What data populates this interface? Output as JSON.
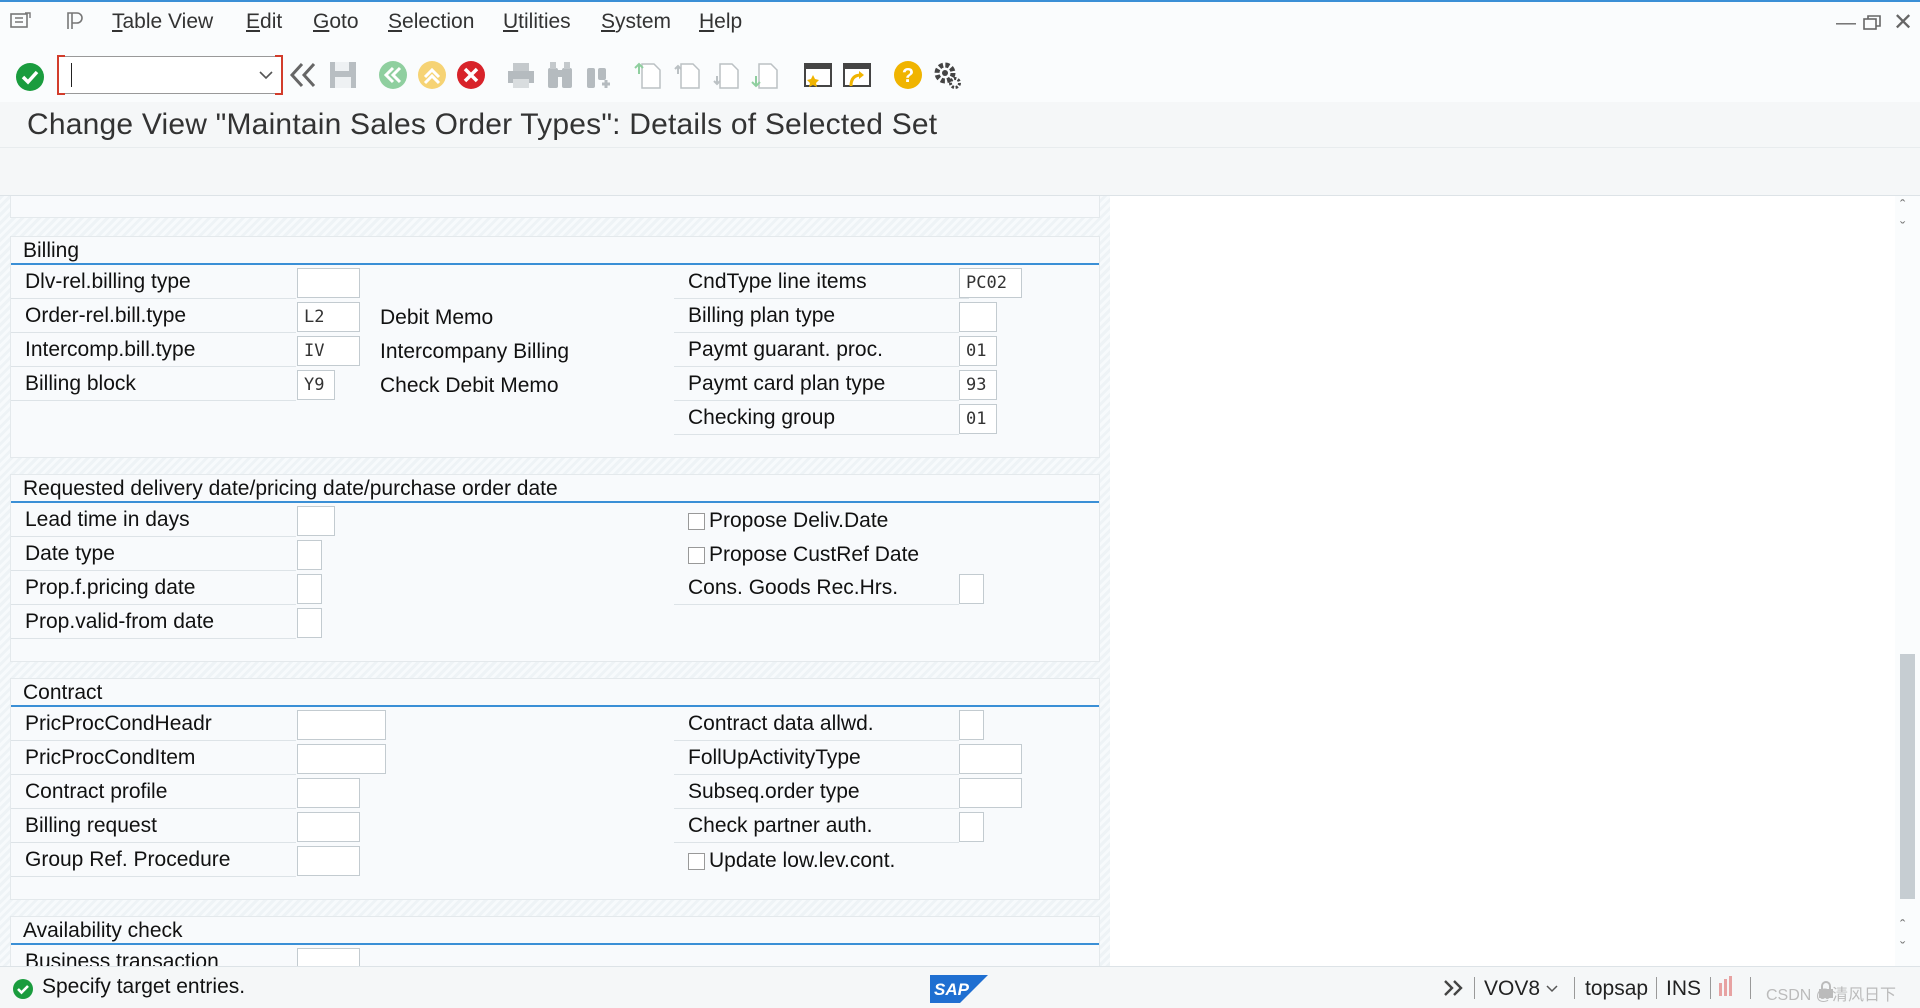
{
  "menubar": {
    "items": [
      "Table View",
      "Edit",
      "Goto",
      "Selection",
      "Utilities",
      "System",
      "Help"
    ]
  },
  "toolbar": {
    "command_value": ""
  },
  "title": "Change View \"Maintain Sales Order Types\": Details of Selected Set",
  "billing": {
    "title": "Billing",
    "left": [
      {
        "label": "Dlv-rel.billing type",
        "value": "",
        "desc": ""
      },
      {
        "label": "Order-rel.bill.type",
        "value": "L2",
        "desc": "Debit Memo"
      },
      {
        "label": "Intercomp.bill.type",
        "value": "IV",
        "desc": "Intercompany Billing"
      },
      {
        "label": "Billing block",
        "value": "Y9",
        "desc": "Check Debit Memo"
      }
    ],
    "right": [
      {
        "label": "CndType line items",
        "value": "PC02"
      },
      {
        "label": "Billing plan type",
        "value": ""
      },
      {
        "label": "Paymt guarant. proc.",
        "value": "01"
      },
      {
        "label": "Paymt card plan type",
        "value": "93"
      },
      {
        "label": "Checking group",
        "value": "01"
      }
    ]
  },
  "dates": {
    "title": "Requested delivery date/pricing date/purchase order date",
    "left": [
      {
        "label": "Lead time in days",
        "value": ""
      },
      {
        "label": "Date type",
        "value": ""
      },
      {
        "label": "Prop.f.pricing date",
        "value": ""
      },
      {
        "label": "Prop.valid-from date",
        "value": ""
      }
    ],
    "checkboxes": [
      "Propose Deliv.Date",
      "Propose CustRef Date"
    ],
    "cons_label": "Cons. Goods Rec.Hrs."
  },
  "contract": {
    "title": "Contract",
    "left": [
      {
        "label": "PricProcCondHeadr",
        "value": ""
      },
      {
        "label": "PricProcCondItem",
        "value": ""
      },
      {
        "label": "Contract profile",
        "value": ""
      },
      {
        "label": "Billing request",
        "value": ""
      },
      {
        "label": "Group Ref. Procedure",
        "value": ""
      }
    ],
    "right": [
      {
        "label": "Contract data allwd.",
        "value": ""
      },
      {
        "label": "FollUpActivityType",
        "value": ""
      },
      {
        "label": "Subseq.order type",
        "value": ""
      },
      {
        "label": "Check partner auth.",
        "value": ""
      }
    ],
    "checkbox": "Update low.lev.cont."
  },
  "availability": {
    "title": "Availability check",
    "first_label": "Business transaction"
  },
  "status": {
    "message": "Specify target entries.",
    "transaction": "VOV8",
    "server": "topsap",
    "mode": "INS",
    "watermark": "CSDN @清风日下"
  },
  "colors": {
    "accent": "#3a8fd6",
    "success": "#1a9c3e",
    "error": "#d8232a",
    "help": "#f0b400"
  }
}
